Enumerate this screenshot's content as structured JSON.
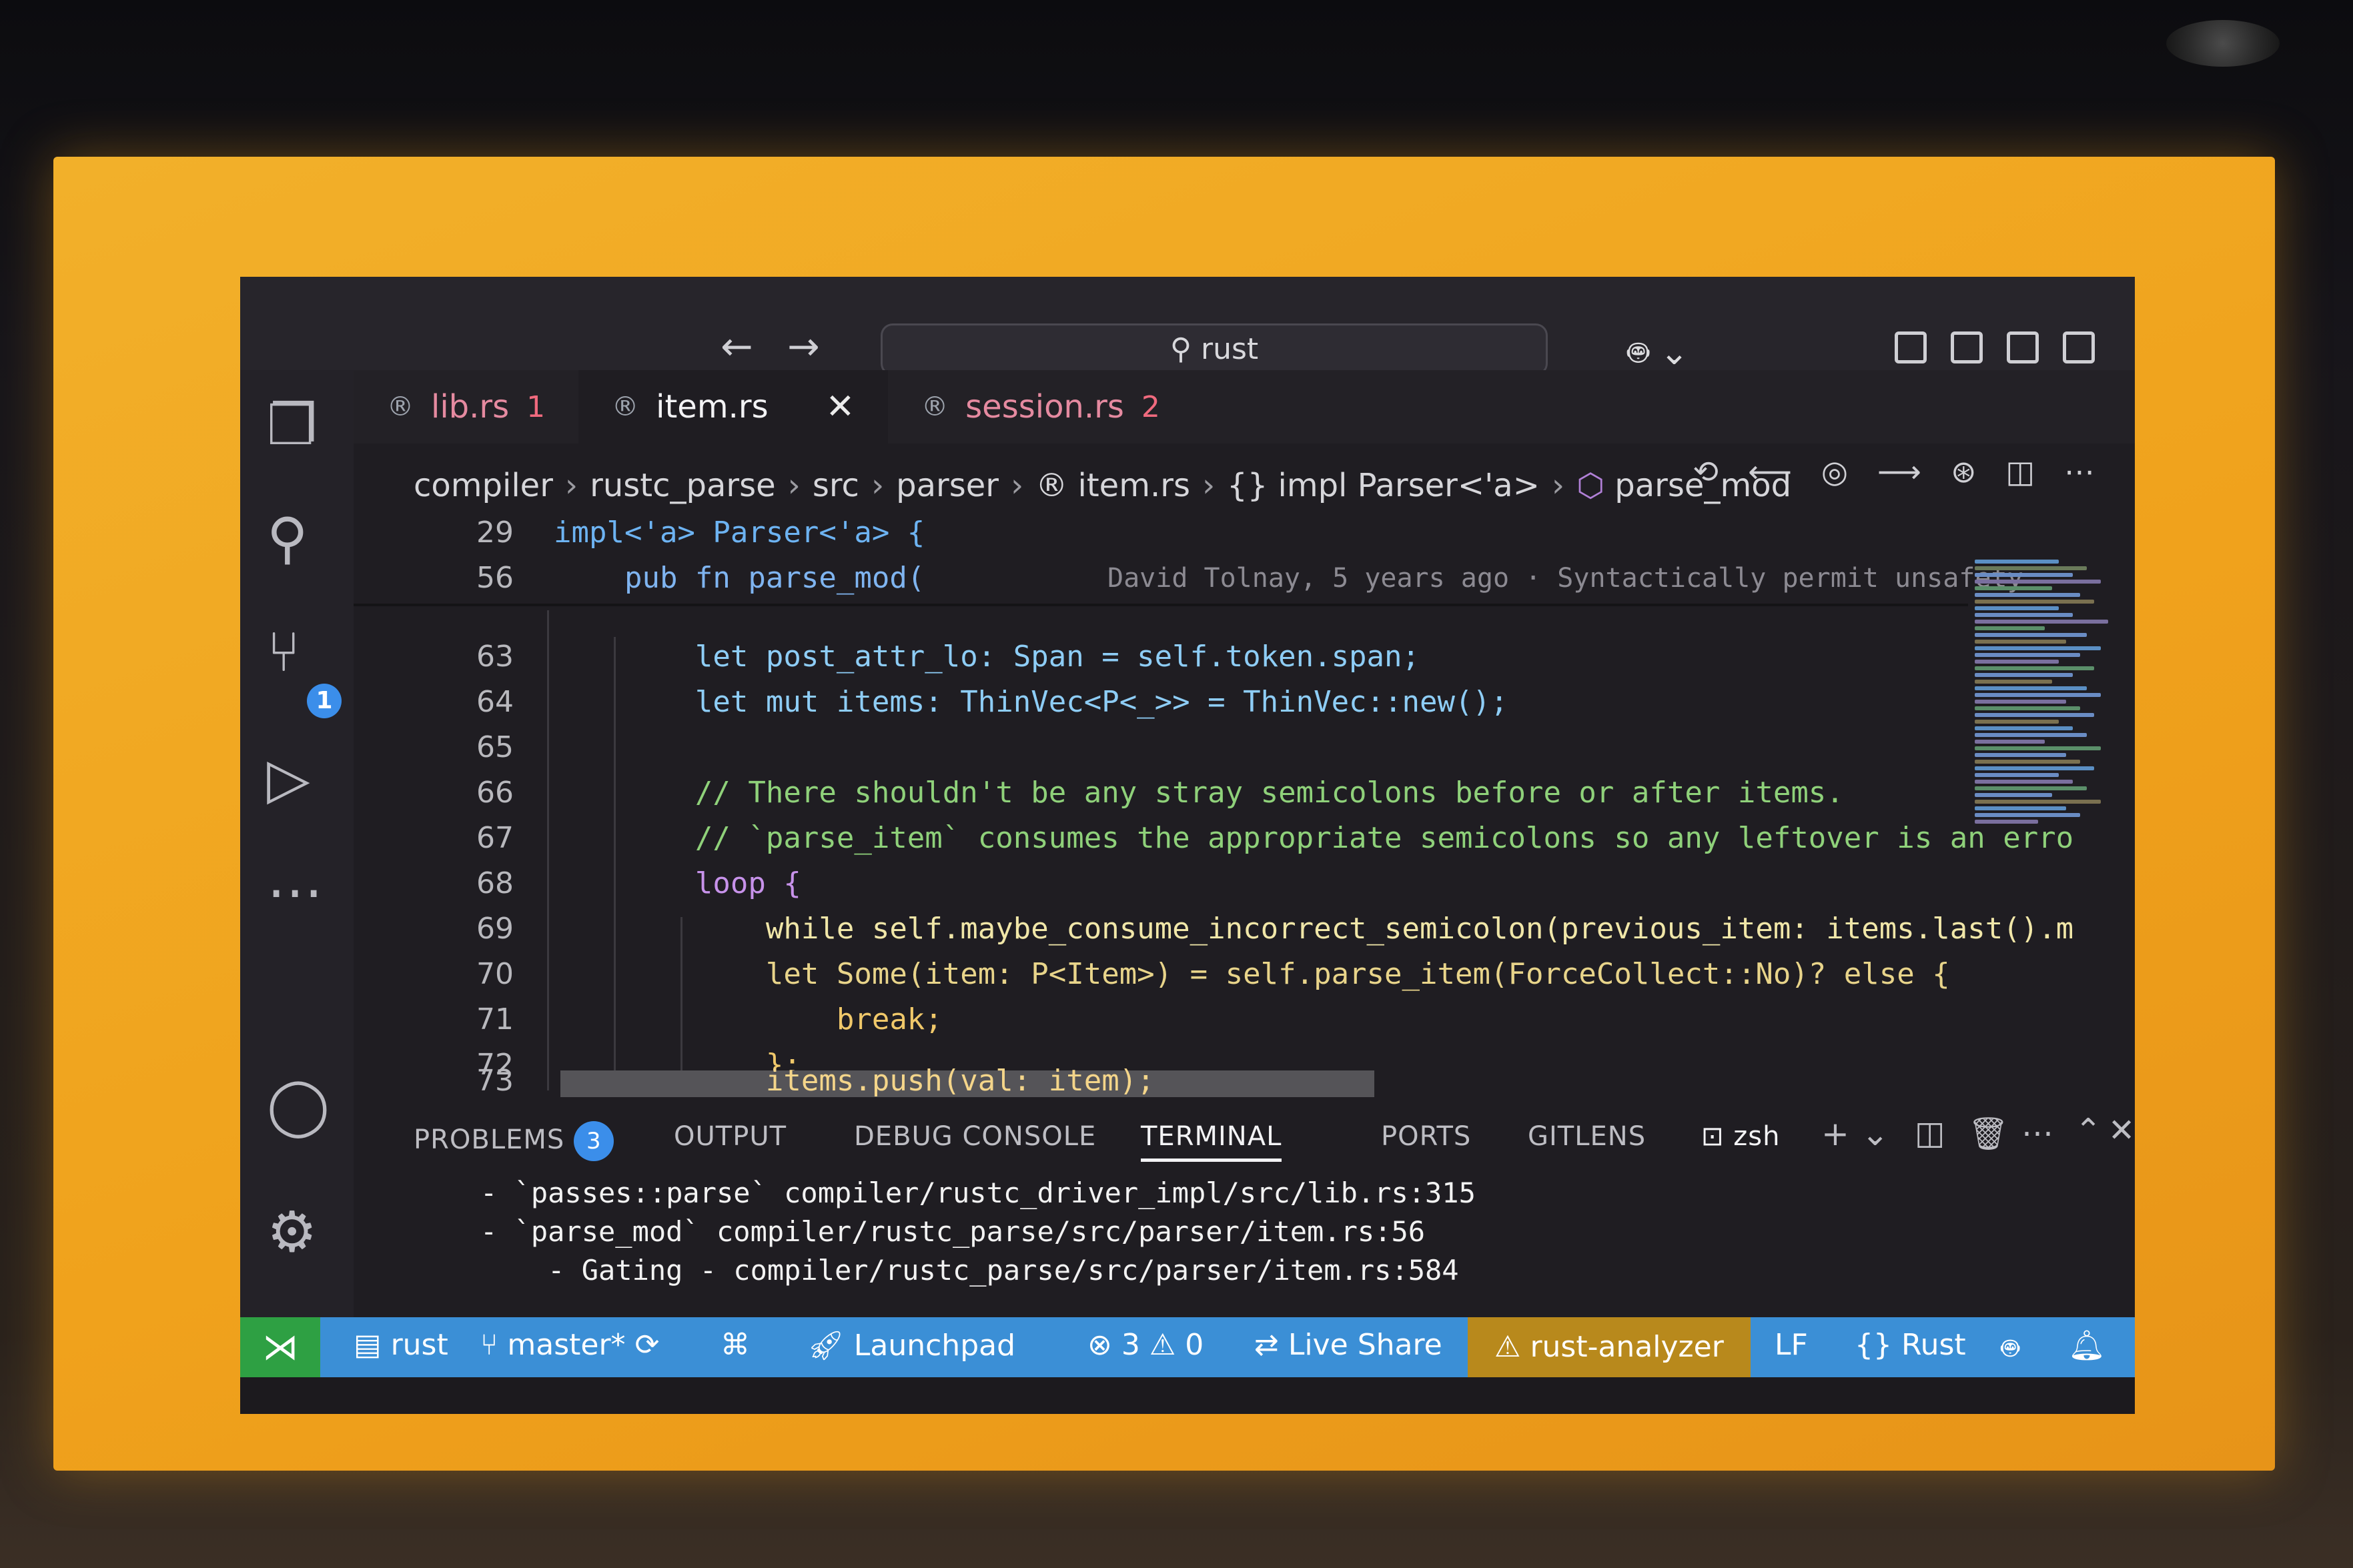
{
  "search": {
    "placeholder_text": "rust"
  },
  "tabs": [
    {
      "label": "lib.rs",
      "count": "1"
    },
    {
      "label": "item.rs",
      "close": "✕"
    },
    {
      "label": "session.rs",
      "count": "2"
    }
  ],
  "breadcrumb": [
    "compiler",
    "rustc_parse",
    "src",
    "parser",
    "item.rs",
    "{} impl Parser<'a>",
    "parse_mod"
  ],
  "code": {
    "lines": [
      {
        "n": "29",
        "text": "impl<'a> Parser<'a> {"
      },
      {
        "n": "56",
        "text": "    pub fn parse_mod(",
        "blame": "David Tolnay, 5 years ago · Syntactically permit unsafety"
      },
      {
        "n": "63",
        "text": "        let post_attr_lo: Span = self.token.span;"
      },
      {
        "n": "64",
        "text": "        let mut items: ThinVec<P<_>> = ThinVec::new();"
      },
      {
        "n": "65",
        "text": ""
      },
      {
        "n": "66",
        "text": "        // There shouldn't be any stray semicolons before or after items."
      },
      {
        "n": "67",
        "text": "        // `parse_item` consumes the appropriate semicolons so any leftover is an erro"
      },
      {
        "n": "68",
        "text": "        loop {"
      },
      {
        "n": "69",
        "text": "            while self.maybe_consume_incorrect_semicolon(previous_item: items.last().m"
      },
      {
        "n": "70",
        "text": "            let Some(item: P<Item>) = self.parse_item(ForceCollect::No)? else {"
      },
      {
        "n": "71",
        "text": "                break;"
      },
      {
        "n": "72",
        "text": "            };"
      },
      {
        "n": "73",
        "text": "            items.push(val: item);"
      }
    ]
  },
  "panel": {
    "tabs": [
      "PROBLEMS",
      "OUTPUT",
      "DEBUG CONSOLE",
      "TERMINAL",
      "PORTS",
      "GITLENS"
    ],
    "problems_count": "3",
    "shell": "zsh",
    "terminal_lines": [
      "- `passes::parse` compiler/rustc_driver_impl/src/lib.rs:315",
      "- `parse_mod` compiler/rustc_parse/src/parser/item.rs:56",
      "    - Gating - compiler/rustc_parse/src/parser/item.rs:584"
    ]
  },
  "statusbar": {
    "repo": "rust",
    "branch": "master*",
    "launchpad": "Launchpad",
    "errors": "3",
    "warnings": "0",
    "live_share": "Live Share",
    "analyzer": "rust-analyzer",
    "eol": "LF",
    "language": "{} Rust"
  },
  "activity_badge": "1"
}
